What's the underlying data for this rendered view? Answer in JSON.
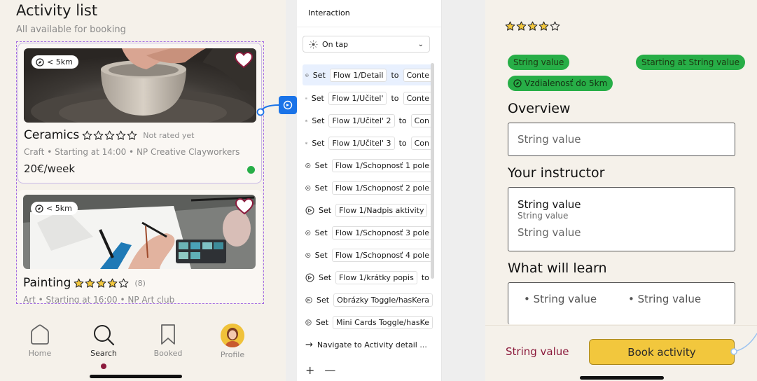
{
  "left_app": {
    "title": "Activity list",
    "subtitle": "All available for booking",
    "cards": [
      {
        "distance": "< 5km",
        "name": "Ceramics",
        "rating": 0,
        "rating_note": "Not rated yet",
        "meta": "Craft • Starting at 14:00 • NP Creative Clayworkers",
        "price": "20€/week",
        "status_color": "#27ae47"
      },
      {
        "distance": "< 5km",
        "name": "Painting",
        "rating": 4,
        "rating_note": "(8)",
        "meta": "Art • Starting at 16:00 • NP Art club"
      }
    ],
    "nav": [
      {
        "label": "Home",
        "icon": "home-icon"
      },
      {
        "label": "Search",
        "icon": "search-icon",
        "active": true
      },
      {
        "label": "Booked",
        "icon": "bookmark-icon"
      },
      {
        "label": "Profile",
        "icon": "avatar"
      }
    ]
  },
  "panel": {
    "title": "Interaction",
    "trigger": "On tap",
    "actions": [
      {
        "verb": "Set",
        "target": "Flow 1/Detail",
        "to": "to",
        "value": "Conte"
      },
      {
        "verb": "Set",
        "target": "Flow 1/Učitel'",
        "to": "to",
        "value": "Conte"
      },
      {
        "verb": "Set",
        "target": "Flow 1/Učitel' 2",
        "to": "to",
        "value": "Con"
      },
      {
        "verb": "Set",
        "target": "Flow 1/Učitel' 3",
        "to": "to",
        "value": "Con"
      },
      {
        "verb": "Set",
        "target": "Flow 1/Schopnosť 1 pole",
        "to": "",
        "value": ""
      },
      {
        "verb": "Set",
        "target": "Flow 1/Schopnosť 2 pole",
        "to": "",
        "value": ""
      },
      {
        "verb": "Set",
        "target": "Flow 1/Nadpis aktivity",
        "to": "",
        "value": ""
      },
      {
        "verb": "Set",
        "target": "Flow 1/Schopnosť 3 pole",
        "to": "",
        "value": ""
      },
      {
        "verb": "Set",
        "target": "Flow 1/Schopnosť 4 pole",
        "to": "",
        "value": ""
      },
      {
        "verb": "Set",
        "target": "Flow 1/krátky popis",
        "to": "to",
        "value": ""
      },
      {
        "verb": "Set",
        "target": "Obrázky Toggle/hasKera",
        "to": "",
        "value": ""
      },
      {
        "verb": "Set",
        "target": "Mini Cards Toggle/hasKe",
        "to": "",
        "value": ""
      }
    ],
    "navigate": "Navigate to Activity detail ...",
    "add_label": "+",
    "remove_label": "—"
  },
  "right_app": {
    "rating": 4,
    "pills": {
      "left": "String value",
      "right": "Starting at String value",
      "distance": "Vzdialenosť do 5km"
    },
    "overview_title": "Overview",
    "overview_value": "String value",
    "instructor_title": "Your instructor",
    "instructor_name": "String value",
    "instructor_sub": "String value",
    "instructor_desc": "String value",
    "learn_title": "What will learn",
    "learn_items": [
      "String value",
      "String value"
    ],
    "price": "String value",
    "book_label": "Book activity"
  },
  "colors": {
    "accent_green": "#27ae47",
    "accent_yellow": "#f2c73d",
    "accent_maroon": "#8b1a3c",
    "figma_blue": "#1a73e8"
  }
}
